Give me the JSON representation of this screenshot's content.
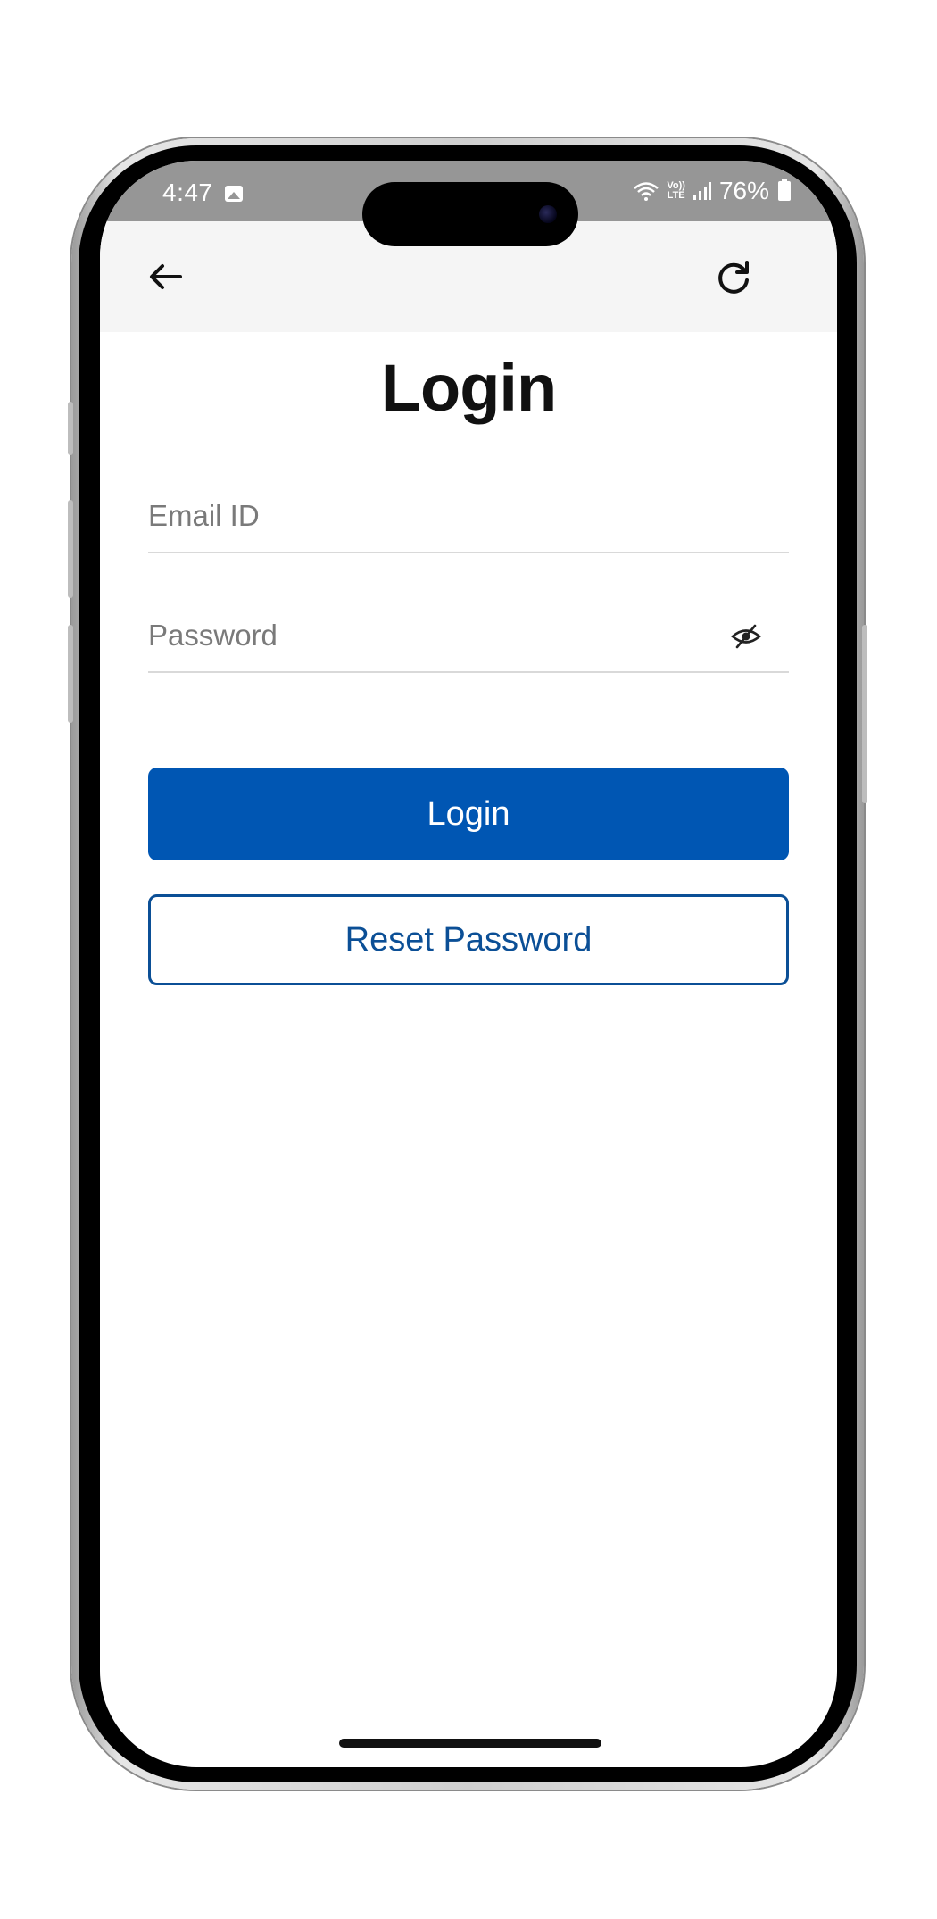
{
  "status_bar": {
    "time": "4:47",
    "volte": "Vo))\nLTE",
    "battery_percent": "76%",
    "icons": [
      "gallery-icon",
      "wifi-icon",
      "volte-icon",
      "signal-icon",
      "battery-icon"
    ]
  },
  "header": {
    "back_icon": "arrow-left-icon",
    "refresh_icon": "refresh-icon"
  },
  "page": {
    "title": "Login"
  },
  "form": {
    "email": {
      "placeholder": "Email ID",
      "value": ""
    },
    "password": {
      "placeholder": "Password",
      "value": "",
      "toggle_icon": "eye-slash-icon"
    },
    "login_label": "Login",
    "reset_label": "Reset Password"
  },
  "colors": {
    "primary": "#0056b3",
    "outline": "#0b4f96",
    "header_bg": "#f5f5f5",
    "status_bg": "#969696"
  }
}
